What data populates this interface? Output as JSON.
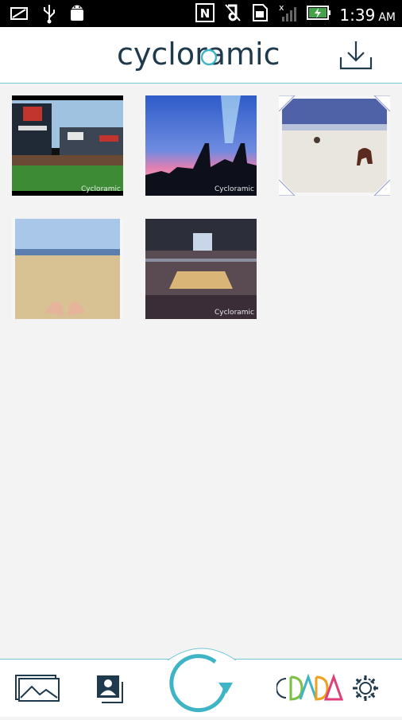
{
  "status_bar": {
    "time": "1:39",
    "ampm": "AM",
    "icons": [
      "screenshot-icon",
      "usb-icon",
      "android-debug-icon",
      "nfc-icon",
      "mute-icon",
      "sd-card-icon",
      "no-signal-icon",
      "battery-charging-icon"
    ]
  },
  "header": {
    "logo_text": "cycloramic",
    "download_icon": "download-icon"
  },
  "gallery": {
    "items": [
      {
        "label": "Stadium photo",
        "watermark": "Cycloramic"
      },
      {
        "label": "City skyline photo",
        "watermark": "Cycloramic"
      },
      {
        "label": "Beach dog photo",
        "watermark": ""
      },
      {
        "label": "Beach sand photo",
        "watermark": ""
      },
      {
        "label": "Arena photo",
        "watermark": "Cycloramic"
      }
    ]
  },
  "bottom_nav": {
    "items": [
      "gallery-icon",
      "profile-gallery-icon",
      "capture-icon",
      "dada-logo-icon",
      "settings-icon"
    ]
  },
  "colors": {
    "accent": "#3fb4c6",
    "logo_dark": "#1f3a4d",
    "background": "#f3f3f3"
  }
}
